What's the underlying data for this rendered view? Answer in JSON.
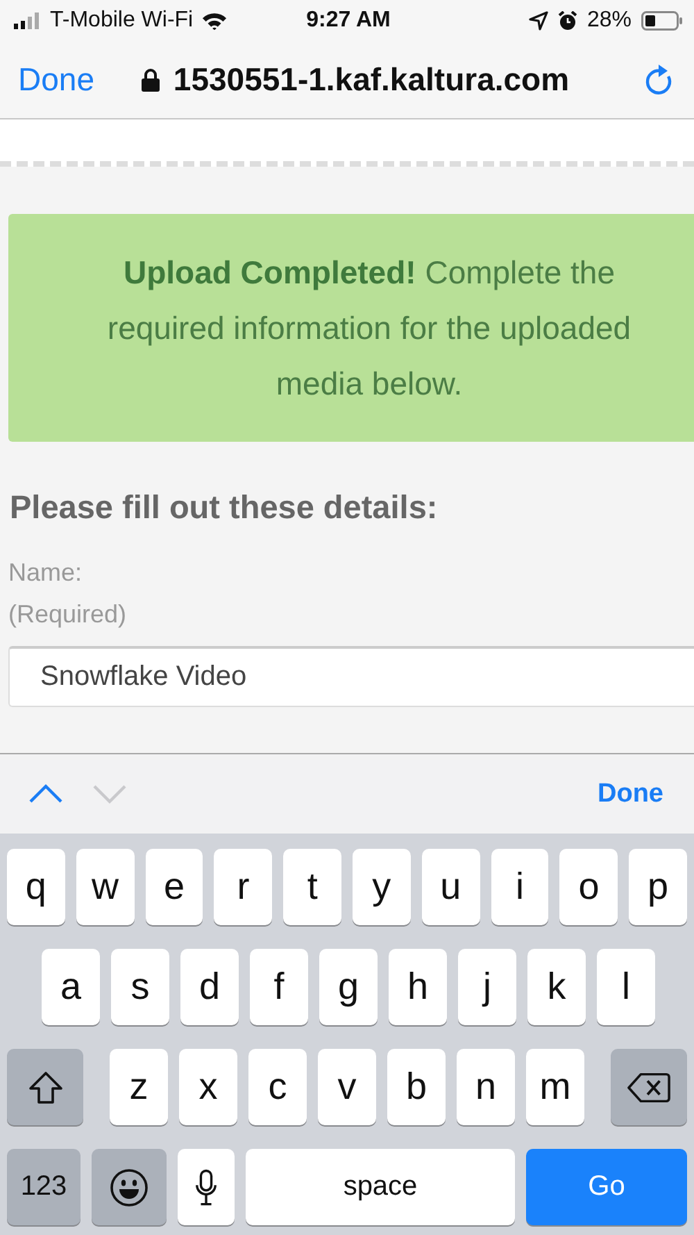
{
  "status_bar": {
    "carrier": "T-Mobile Wi-Fi",
    "time": "9:27 AM",
    "battery": "28%"
  },
  "browser_bar": {
    "done": "Done",
    "url": "1530551-1.kaf.kaltura.com"
  },
  "alert": {
    "message": "**Upload Completed!** Complete the required information for the uploaded media below."
  },
  "form": {
    "heading": "Please fill out these details:",
    "field_label": "Name:",
    "field_note": "(Required)",
    "field_value": "Snowflake Video"
  },
  "accessory_bar": {
    "navigation": [
      {
        "kind": "up",
        "disabled": false
      },
      {
        "kind": "down",
        "disabled": true
      }
    ],
    "done": "Done"
  },
  "keyboard": {
    "rows": [
      {
        "keys": [
          {
            "kind": "letter",
            "label": "q"
          },
          {
            "kind": "letter",
            "label": "w"
          },
          {
            "kind": "letter",
            "label": "e"
          },
          {
            "kind": "letter",
            "label": "r"
          },
          {
            "kind": "letter",
            "label": "t"
          },
          {
            "kind": "letter",
            "label": "y"
          },
          {
            "kind": "letter",
            "label": "u"
          },
          {
            "kind": "letter",
            "label": "i"
          },
          {
            "kind": "letter",
            "label": "o"
          },
          {
            "kind": "letter",
            "label": "p"
          }
        ]
      },
      {
        "keys": [
          {
            "kind": "letter",
            "label": "a"
          },
          {
            "kind": "letter",
            "label": "s"
          },
          {
            "kind": "letter",
            "label": "d"
          },
          {
            "kind": "letter",
            "label": "f"
          },
          {
            "kind": "letter",
            "label": "g"
          },
          {
            "kind": "letter",
            "label": "h"
          },
          {
            "kind": "letter",
            "label": "j"
          },
          {
            "kind": "letter",
            "label": "k"
          },
          {
            "kind": "letter",
            "label": "l"
          }
        ]
      },
      {
        "keys": [
          {
            "kind": "shift"
          },
          {
            "kind": "letter",
            "label": "z"
          },
          {
            "kind": "letter",
            "label": "x"
          },
          {
            "kind": "letter",
            "label": "c"
          },
          {
            "kind": "letter",
            "label": "v"
          },
          {
            "kind": "letter",
            "label": "b"
          },
          {
            "kind": "letter",
            "label": "n"
          },
          {
            "kind": "letter",
            "label": "m"
          },
          {
            "kind": "delete"
          }
        ]
      },
      {
        "keys": [
          {
            "kind": "numbers",
            "label": "123"
          },
          {
            "kind": "emoji"
          },
          {
            "kind": "mic"
          },
          {
            "kind": "space",
            "label": "space"
          },
          {
            "kind": "go",
            "label": "Go"
          }
        ]
      }
    ]
  }
}
